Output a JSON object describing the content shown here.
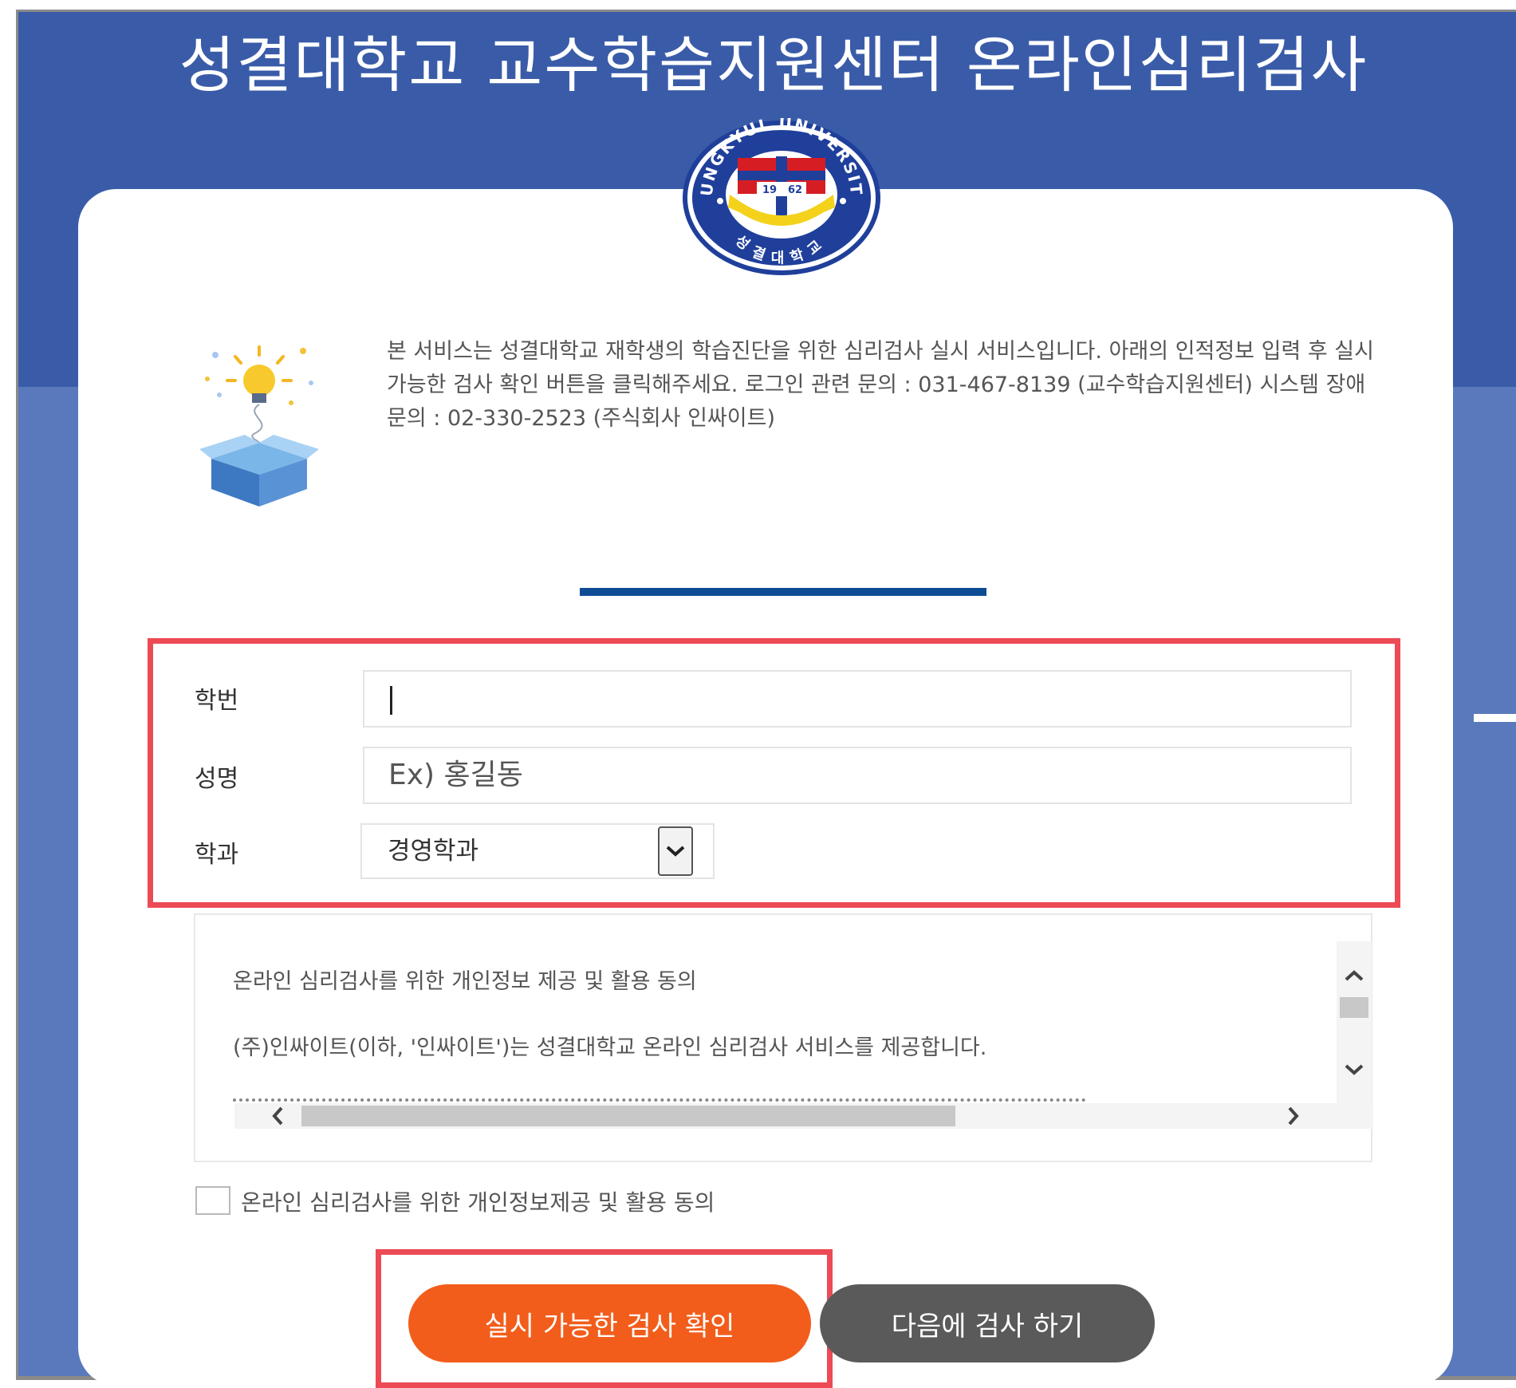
{
  "header": {
    "title": "성결대학교 교수학습지원센터 온라인심리검사",
    "logo": {
      "ring_text_top": "SUNGKYUL UNIVERSITY",
      "ring_text_bottom": "성결대학교",
      "year_left": "19",
      "year_right": "62"
    }
  },
  "notice": {
    "text": "본 서비스는 성결대학교 재학생의 학습진단을 위한 심리검사 실시 서비스입니다. 아래의 인적정보 입력 후 실시 가능한 검사 확인 버튼을 클릭해주세요. 로그인 관련 문의 : 031-467-8139 (교수학습지원센터) 시스템 장애 문의 : 02-330-2523 (주식회사 인싸이트)"
  },
  "form": {
    "student_id": {
      "label": "학번",
      "value": ""
    },
    "name": {
      "label": "성명",
      "placeholder": "Ex) 홍길동"
    },
    "department": {
      "label": "학과",
      "selected": "경영학과"
    }
  },
  "consent": {
    "heading": "온라인 심리검사를 위한 개인정보 제공 및 활용 동의",
    "body_line1": "(주)인싸이트(이하, '인싸이트')는 성결대학교 온라인 심리검사 서비스를 제공합니다.",
    "checkbox_label": "온라인 심리검사를 위한 개인정보제공 및 활용 동의",
    "checked": false
  },
  "buttons": {
    "check_label": "실시 가능한 검사 확인",
    "later_label": "다음에 검사 하기"
  },
  "colors": {
    "header_blue": "#3a5ca8",
    "lower_blue": "#5a79bd",
    "divider_blue": "#0e4d96",
    "primary_orange": "#f25d1b",
    "secondary_gray": "#5a5a5a",
    "highlight_red": "#ec4a55"
  },
  "icons": [
    "university-logo",
    "idea-box-icon",
    "chevron-down-icon",
    "chevron-up-icon",
    "chevron-left-icon",
    "chevron-right-icon"
  ]
}
